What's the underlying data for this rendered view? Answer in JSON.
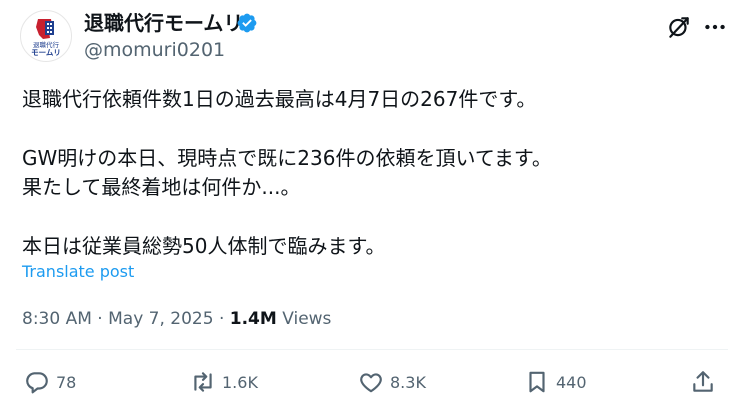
{
  "author": {
    "display_name": "退職代行モームリ",
    "handle": "@momuri0201",
    "verified": true,
    "avatar_logo_text": [
      "退職代行",
      "モームリ"
    ]
  },
  "post": {
    "lines": [
      "退職代行依頼件数1日の過去最高は4月7日の267件です。",
      "GW明けの本日、現時点で既に236件の依頼を頂いてます。",
      "果たして最終着地は何件か...。",
      "本日は従業員総勢50人体制で臨みます。"
    ],
    "translate_label": "Translate post"
  },
  "meta": {
    "time": "8:30 AM",
    "separator": "·",
    "date": "May 7, 2025",
    "views_count": "1.4M",
    "views_label": "Views"
  },
  "actions": {
    "replies": "78",
    "reposts": "1.6K",
    "likes": "8.3K",
    "bookmarks": "440"
  },
  "icons": {
    "verified": "verified-badge-icon",
    "grok": "grok-icon",
    "more": "more-icon",
    "reply": "reply-icon",
    "repost": "repost-icon",
    "like": "heart-icon",
    "bookmark": "bookmark-icon",
    "share": "share-icon"
  },
  "colors": {
    "accent": "#1d9bf0",
    "text": "#0f1419",
    "muted": "#536471",
    "logo_red": "#c8202f",
    "logo_blue": "#1f3f8f"
  }
}
